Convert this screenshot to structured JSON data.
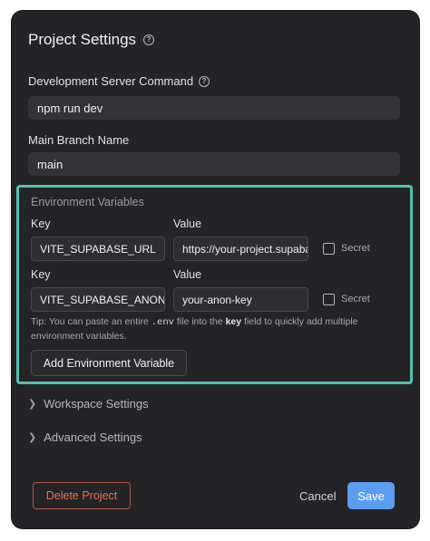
{
  "dialog": {
    "title": "Project Settings",
    "title_help_icon": "help-circle-icon"
  },
  "dev_server": {
    "label": "Development Server Command",
    "help_icon": "help-circle-icon",
    "value": "npm run dev"
  },
  "main_branch": {
    "label": "Main Branch Name",
    "value": "main"
  },
  "env_vars": {
    "title": "Environment Variables",
    "key_header": "Key",
    "value_header": "Value",
    "secret_label": "Secret",
    "rows": [
      {
        "key": "VITE_SUPABASE_URL",
        "value": "https://your-project.supabase.co",
        "secret": false
      },
      {
        "key": "VITE_SUPABASE_ANON_KEY",
        "value": "your-anon-key",
        "secret": false
      }
    ],
    "tip_prefix": "Tip: You can paste an entire",
    "tip_code": ".env",
    "tip_mid": "file into the",
    "tip_bold": "key",
    "tip_suffix": "field to quickly add multiple environment variables.",
    "add_button": "Add Environment Variable"
  },
  "sections": {
    "workspace": "Workspace Settings",
    "advanced": "Advanced Settings",
    "chevron_icon": "chevron-right-icon"
  },
  "footer": {
    "delete_button": "Delete Project",
    "cancel_button": "Cancel",
    "save_button": "Save"
  },
  "colors": {
    "dialog_bg": "#242427",
    "highlight_border": "#54bfb0",
    "primary": "#5b9df0",
    "danger": "#e0774f"
  }
}
